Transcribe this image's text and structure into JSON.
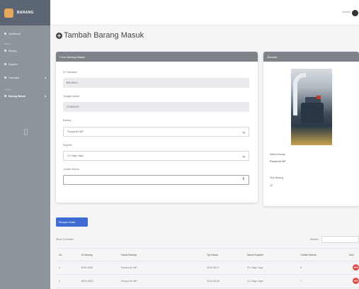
{
  "sidebar": {
    "brand": "BARANG",
    "items": [
      {
        "label": "Dashboard",
        "type": "item"
      },
      {
        "label": "Master",
        "type": "header"
      },
      {
        "label": "Barang",
        "type": "item"
      },
      {
        "label": "Supplier",
        "type": "item"
      },
      {
        "label": "Transaksi",
        "type": "item"
      },
      {
        "label": "Laporan",
        "type": "header"
      },
      {
        "label": "Barang Masuk",
        "type": "item"
      }
    ]
  },
  "topbar": {
    "user": "Admin"
  },
  "page": {
    "title": "Tambah Barang Masuk"
  },
  "form": {
    "header": "Form Barang Masuk",
    "fields": [
      {
        "label": "ID Transaksi",
        "value": "BM-00001"
      },
      {
        "label": "Tanggal Masuk",
        "value": "27/08/2022"
      },
      {
        "label": "Barang",
        "value": "Pompa Air WP"
      },
      {
        "label": "Supplier",
        "value": "CV. Maju Jaya"
      },
      {
        "label": "Jumlah Masuk",
        "value": ""
      }
    ]
  },
  "photo_card": {
    "header": "Gambar",
    "name_label": "Nama Barang",
    "name_value": "Pompa Air WP",
    "stock_label": "Stok Barang",
    "stock_value": "12"
  },
  "actions": {
    "save_label": "Simpan Data"
  },
  "table": {
    "show_entries": "Show 10 entries",
    "search_label": "Search:",
    "columns": [
      "No",
      "ID Barang",
      "Nama Barang",
      "Tgl Masuk",
      "Nama Supplier",
      "Jumlah Masuk",
      "Aksi"
    ],
    "rows": [
      [
        "1",
        "BRG-0001",
        "Pompa Air WP",
        "2022-08-27",
        "CV. Maju Jaya",
        "5"
      ],
      [
        "2",
        "BRG-0002",
        "Pompa Air WP",
        "2022-08-28",
        "CV. Maju Jaya",
        "7"
      ]
    ]
  },
  "colors": {
    "primary": "#3f6cd2",
    "danger": "#e0524a",
    "sidebar": "#8d949c",
    "card_header": "#7d8389"
  }
}
